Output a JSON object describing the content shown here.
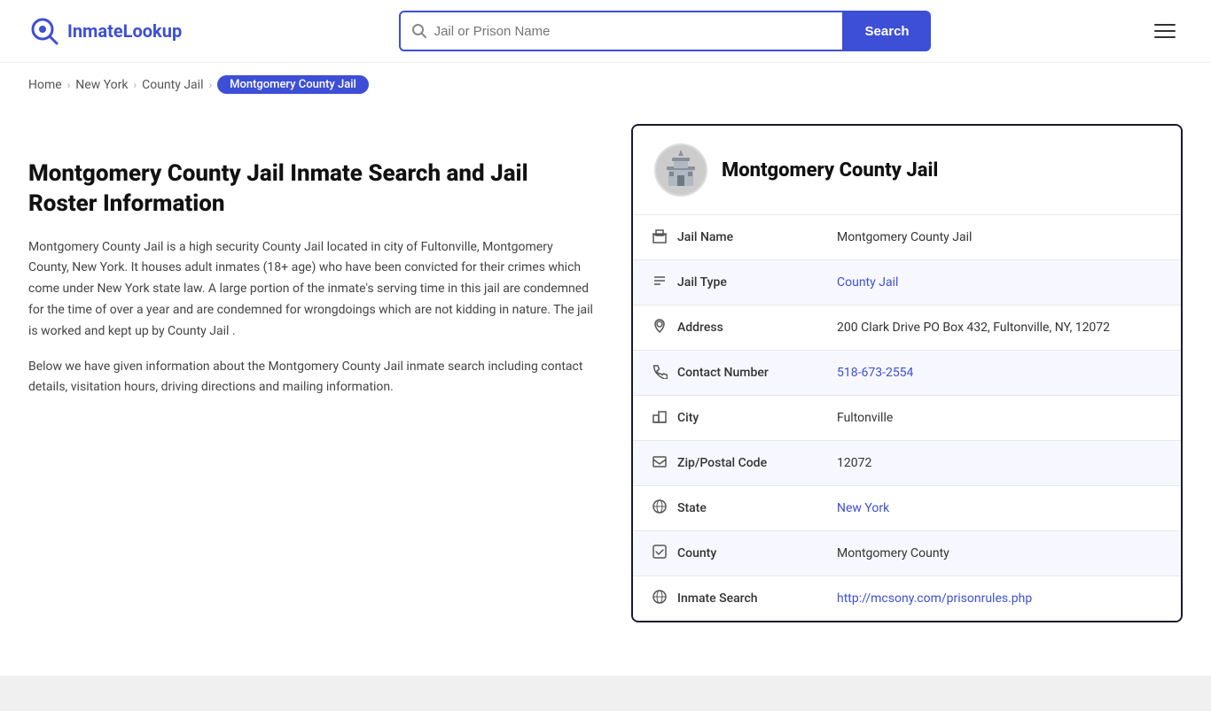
{
  "site": {
    "logo_text_plain": "Inmate",
    "logo_text_accent": "Lookup"
  },
  "header": {
    "search_placeholder": "Jail or Prison Name",
    "search_button_label": "Search",
    "menu_label": "Menu"
  },
  "breadcrumb": {
    "home": "Home",
    "state": "New York",
    "category": "County Jail",
    "current": "Montgomery County Jail"
  },
  "left": {
    "heading": "Montgomery County Jail Inmate Search and Jail Roster Information",
    "paragraph1": "Montgomery County Jail is a high security County Jail located in city of Fultonville, Montgomery County, New York. It houses adult inmates (18+ age) who have been convicted for their crimes which come under New York state law. A large portion of the inmate's serving time in this jail are condemned for the time of over a year and are condemned for wrongdoings which are not kidding in nature. The jail is worked and kept up by County Jail .",
    "paragraph2": "Below we have given information about the Montgomery County Jail inmate search including contact details, visitation hours, driving directions and mailing information."
  },
  "card": {
    "title": "Montgomery County Jail",
    "rows": [
      {
        "icon": "jail-icon",
        "label": "Jail Name",
        "value": "Montgomery County Jail",
        "link": null
      },
      {
        "icon": "type-icon",
        "label": "Jail Type",
        "value": "County Jail",
        "link": "#"
      },
      {
        "icon": "address-icon",
        "label": "Address",
        "value": "200 Clark Drive PO Box 432, Fultonville, NY, 12072",
        "link": null
      },
      {
        "icon": "phone-icon",
        "label": "Contact Number",
        "value": "518-673-2554",
        "link": "tel:518-673-2554"
      },
      {
        "icon": "city-icon",
        "label": "City",
        "value": "Fultonville",
        "link": null
      },
      {
        "icon": "zip-icon",
        "label": "Zip/Postal Code",
        "value": "12072",
        "link": null
      },
      {
        "icon": "state-icon",
        "label": "State",
        "value": "New York",
        "link": "#"
      },
      {
        "icon": "county-icon",
        "label": "County",
        "value": "Montgomery County",
        "link": null
      },
      {
        "icon": "inmate-icon",
        "label": "Inmate Search",
        "value": "http://mcsony.com/prisonrules.php",
        "link": "http://mcsony.com/prisonrules.php"
      }
    ]
  }
}
